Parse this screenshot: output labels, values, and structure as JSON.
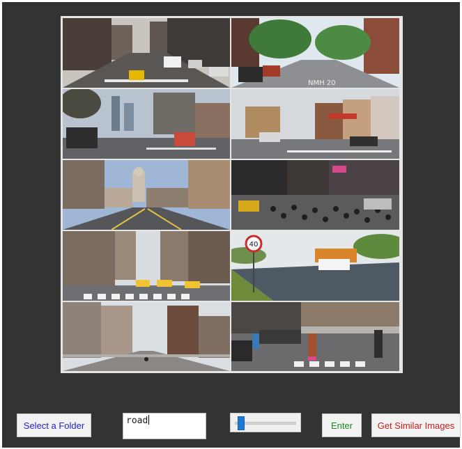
{
  "image_grid": {
    "tiles": [
      {
        "name": "tile-city-avenue-traffic",
        "sky": "#c9c4bd",
        "road": "#5a5654",
        "buildings": "#4a3f38"
      },
      {
        "name": "tile-tree-lined-street",
        "sky": "#dfe7ef",
        "road": "#8d8f93",
        "buildings": "#3f7a3a"
      },
      {
        "name": "tile-skyline-crosswalk",
        "sky": "#b8c3cf",
        "road": "#616266",
        "buildings": "#6f6a64"
      },
      {
        "name": "tile-small-town-street",
        "sky": "#d6d9de",
        "road": "#76787c",
        "buildings": "#8a5a40"
      },
      {
        "name": "tile-city-hall-avenue",
        "sky": "#9fb6d6",
        "road": "#55565a",
        "buildings": "#a98d72"
      },
      {
        "name": "tile-crowded-intersection",
        "sky": "#3d3835",
        "road": "#5b5b5e",
        "buildings": "#2c2a2b"
      },
      {
        "name": "tile-taxi-crosswalk",
        "sky": "#d8dde2",
        "road": "#6c6e72",
        "buildings": "#7b6c5f"
      },
      {
        "name": "tile-highway-40-sign",
        "sky": "#e5e8ea",
        "road": "#4f5963",
        "buildings": "#5e8a3e"
      },
      {
        "name": "tile-empty-street",
        "sky": "#d9dee3",
        "road": "#8a8785",
        "buildings": "#6d4b3c"
      },
      {
        "name": "tile-pedestrian-crossing",
        "sky": "#b7b3ae",
        "road": "#6b6b6e",
        "buildings": "#4b4745"
      }
    ]
  },
  "controls": {
    "select_folder_label": "Select a Folder",
    "query_value": "road",
    "slider_value": 0.05,
    "enter_label": "Enter",
    "similar_label": "Get Similar Images"
  },
  "colors": {
    "window_bg": "#333333",
    "folder_text": "#2323c8",
    "enter_text": "#1a8a1a",
    "similar_text": "#c02020",
    "slider_thumb": "#1e78d7"
  },
  "speed_sign": "40"
}
